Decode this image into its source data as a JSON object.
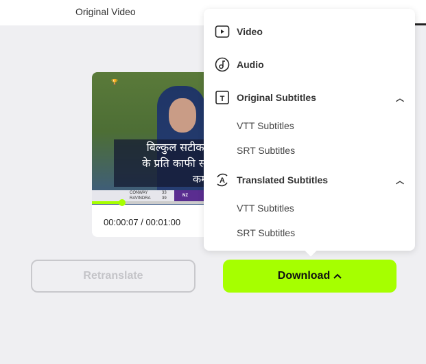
{
  "tabs": {
    "original": "Original Video"
  },
  "video": {
    "subtitle_lines": [
      "बिल्कुल सटीक, अ",
      "के प्रति काफी सचेत",
      "कम अ"
    ],
    "scoreboard": {
      "batter1": "CONWAY",
      "batter2": "RAVINDRA",
      "score1": "33",
      "score2": "39",
      "team": "NZ"
    },
    "progress_percent": 12,
    "time": "00:00:07 / 00:01:00"
  },
  "menu": {
    "video": "Video",
    "audio": "Audio",
    "original_subtitles": "Original Subtitles",
    "translated_subtitles": "Translated Subtitles",
    "vtt": "VTT Subtitles",
    "srt": "SRT Subtitles"
  },
  "buttons": {
    "retranslate": "Retranslate",
    "download": "Download"
  },
  "colors": {
    "accent": "#a6ff00"
  }
}
